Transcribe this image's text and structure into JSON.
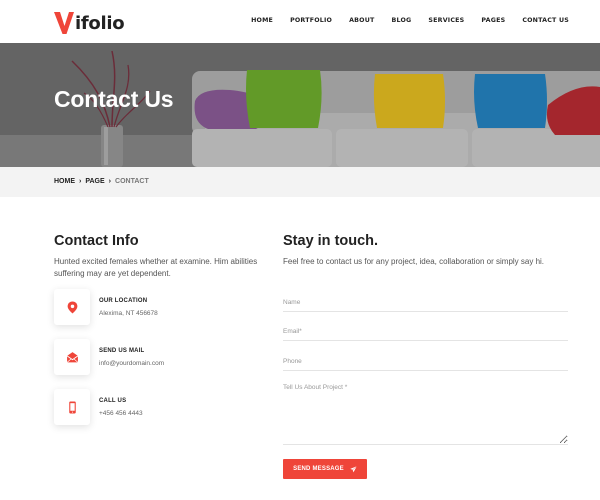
{
  "brand": {
    "logo_initial": "V",
    "logo_rest": "ifolio",
    "accent_color": "#ef4539"
  },
  "nav": {
    "items": [
      "HOME",
      "PORTFOLIO",
      "ABOUT",
      "BLOG",
      "SERVICES",
      "PAGES",
      "CONTACT US"
    ]
  },
  "hero": {
    "title": "Contact Us"
  },
  "breadcrumb": {
    "home": "HOME",
    "page": "PAGE",
    "current": "CONTACT"
  },
  "contact_info": {
    "title": "Contact Info",
    "description": "Hunted excited females whether at examine. Him abilities suffering may are yet dependent.",
    "items": [
      {
        "icon": "location-pin-icon",
        "label": "OUR LOCATION",
        "value": "Alexima, NT 456678"
      },
      {
        "icon": "envelope-icon",
        "label": "SEND US MAIL",
        "value": "info@yourdomain.com"
      },
      {
        "icon": "phone-icon",
        "label": "CALL US",
        "value": "+456 456 4443"
      }
    ]
  },
  "form": {
    "title": "Stay in touch.",
    "description": "Feel free to contact us for any project, idea, collaboration or simply say hi.",
    "name_placeholder": "Name",
    "email_placeholder": "Email*",
    "phone_placeholder": "Phone",
    "message_placeholder": "Tell Us About Project *",
    "submit_label": "SEND MESSAGE"
  }
}
